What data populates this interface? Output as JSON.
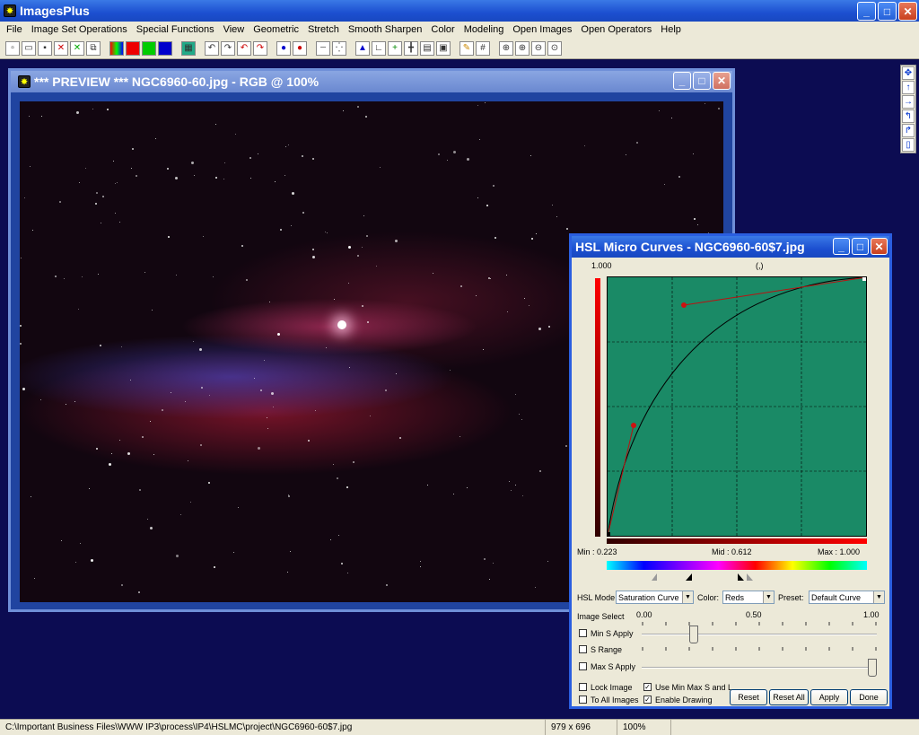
{
  "app": {
    "title": "ImagesPlus"
  },
  "menu": [
    "File",
    "Image Set Operations",
    "Special Functions",
    "View",
    "Geometric",
    "Stretch",
    "Smooth Sharpen",
    "Color",
    "Modeling",
    "Open Images",
    "Open Operators",
    "Help"
  ],
  "preview": {
    "title": "*** PREVIEW *** NGC6960-60.jpg - RGB @ 100%"
  },
  "hsl": {
    "title": "HSL Micro Curves - NGC6960-60$7.jpg",
    "top_left_value": "1.000",
    "coord_readout": "(,)",
    "min_label": "Min : 0.223",
    "mid_label": "Mid : 0.612",
    "max_label": "Max : 1.000",
    "mode_label": "HSL Mode:",
    "mode_value": "Saturation Curve",
    "color_label": "Color:",
    "color_value": "Reds",
    "preset_label": "Preset:",
    "preset_value": "Default Curve",
    "image_select": "Image Select",
    "scale_0": "0.00",
    "scale_mid": "0.50",
    "scale_1": "1.00",
    "min_s_apply": "Min S Apply",
    "s_range": "S Range",
    "max_s_apply": "Max S Apply",
    "lock_image": "Lock Image",
    "to_all_images": "To All Images",
    "use_min_max": "Use Min Max S and L",
    "enable_drawing": "Enable Drawing",
    "btn_reset": "Reset",
    "btn_reset_all": "Reset All",
    "btn_apply": "Apply",
    "btn_done": "Done",
    "min_s_slider_fraction": 0.22,
    "max_s_slider_fraction": 1.0
  },
  "status": {
    "path": "C:\\Important Business Files\\WWW IP3\\process\\IP4\\HSLMC\\project\\NGC6960-60$7.jpg",
    "dims": "979 x 696",
    "zoom": "100%"
  },
  "colors": {
    "curve_bg": "#1a8a66",
    "control_point": "#cc1111",
    "accent": "#2a5ee0"
  }
}
